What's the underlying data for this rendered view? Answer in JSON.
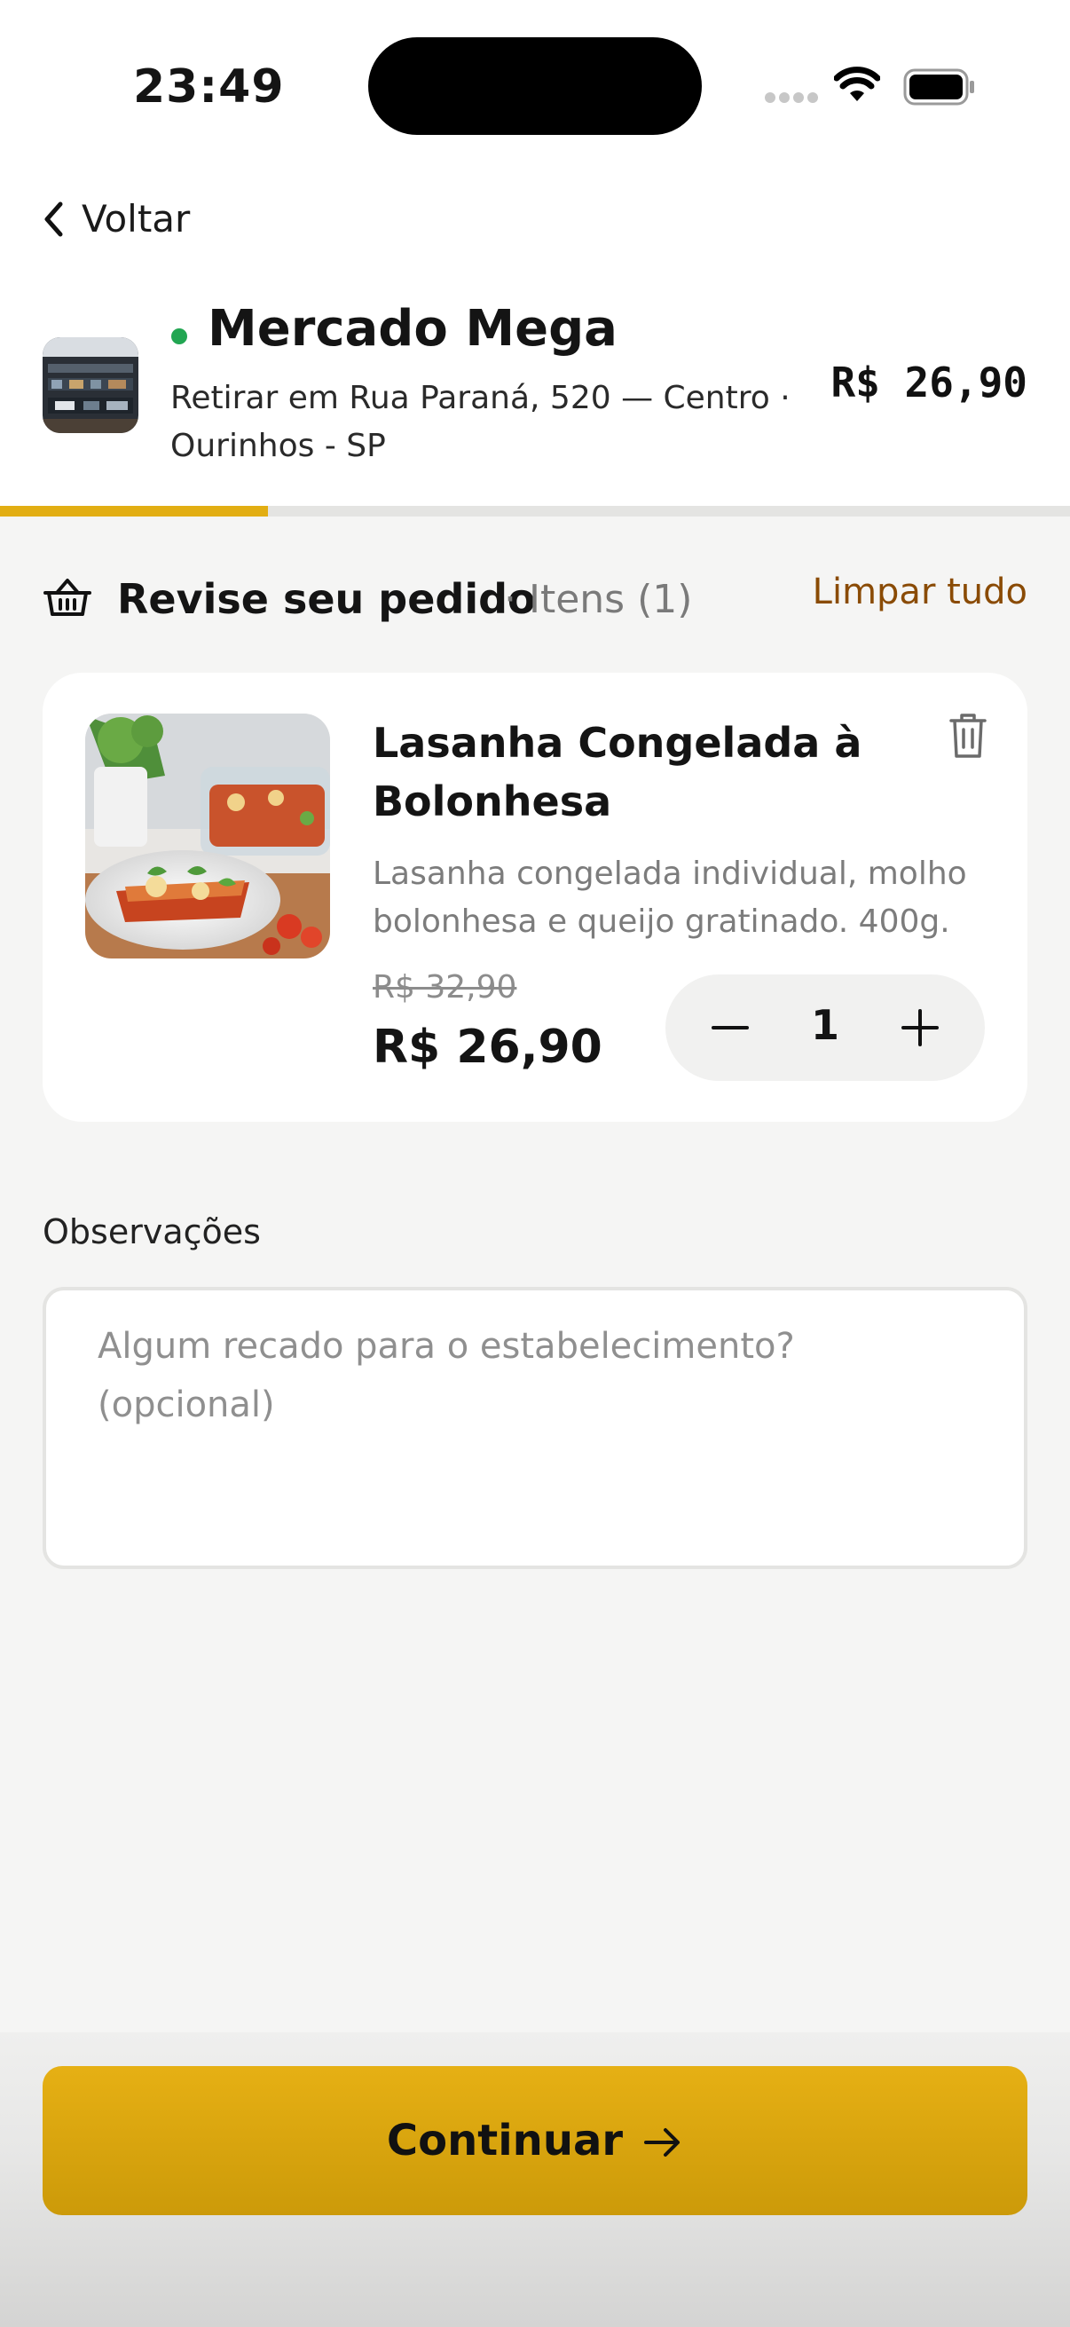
{
  "status_bar": {
    "time": "23:49"
  },
  "nav": {
    "back_label": "Voltar"
  },
  "store": {
    "name": "Mercado Mega",
    "address": "Retirar em Rua Paraná, 520 — Centro · Ourinhos - SP",
    "total": "R$ 26,90",
    "progress": 0.25,
    "status_color": "#22a652"
  },
  "order": {
    "title": "Revise seu pedido",
    "count_label": "· Itens (1)",
    "clear_label": "Limpar tudo",
    "items": [
      {
        "name": "Lasanha Congelada à Bolonhesa",
        "description": "Lasanha congelada individual, molho bolonhesa e queijo gratinado. 400g.",
        "old_price": "R$ 32,90",
        "price": "R$ 26,90",
        "quantity": "1",
        "image_icon": "lasagna-photo"
      }
    ]
  },
  "notes": {
    "label": "Observações",
    "placeholder": "Algum recado para o estabelecimento? (opcional)",
    "value": ""
  },
  "footer": {
    "continue_label": "Continuar"
  },
  "colors": {
    "accent": "#e2ae13",
    "link": "#8a4b05"
  },
  "icons": [
    "chevron-left-icon",
    "wifi-icon",
    "battery-icon",
    "basket-icon",
    "trash-icon",
    "minus-icon",
    "plus-icon",
    "arrow-right-icon"
  ]
}
